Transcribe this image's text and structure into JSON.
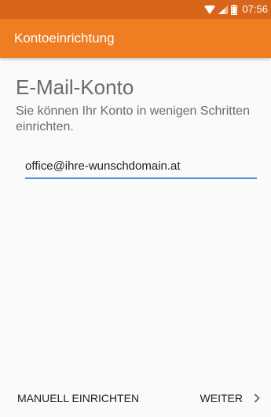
{
  "status_bar": {
    "time": "07:56",
    "icons": [
      "wifi-icon",
      "signal-icon",
      "battery-icon"
    ],
    "color": "#d8661a"
  },
  "app_bar": {
    "title": "Kontoeinrichtung",
    "color": "#ef7d22"
  },
  "main": {
    "heading": "E-Mail-Konto",
    "description": "Sie können Ihr Konto in wenigen Schritten einrichten.",
    "email_field": {
      "value": "office@ihre-wunschdomain.at",
      "underline_color": "#4a90e2"
    }
  },
  "bottom_bar": {
    "manual_label": "MANUELL EINRICHTEN",
    "next_label": "WEITER",
    "next_icon": "chevron-right-icon"
  }
}
